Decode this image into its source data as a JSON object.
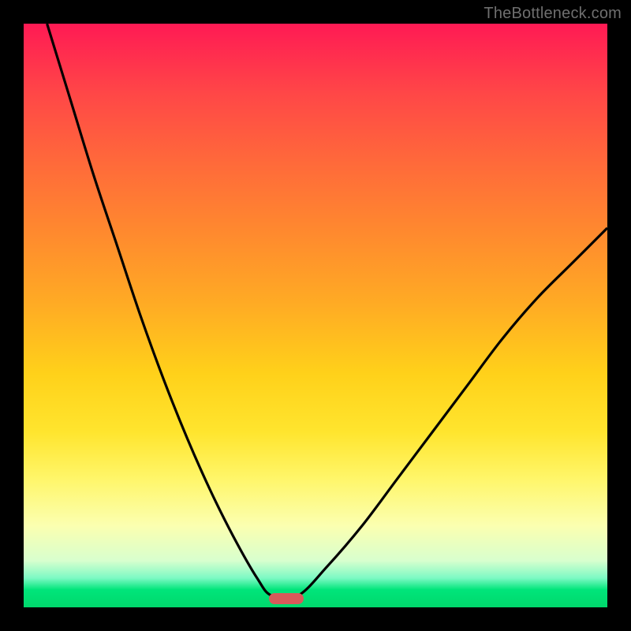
{
  "watermark": "TheBottleneck.com",
  "colors": {
    "page_bg": "#000000",
    "marker": "#d85a5a",
    "curve_stroke": "#000000"
  },
  "chart_data": {
    "type": "line",
    "title": "",
    "xlabel": "",
    "ylabel": "",
    "xlim": [
      0,
      100
    ],
    "ylim": [
      0,
      100
    ],
    "note": "Axes are unlabeled; values are estimated from pixel positions where x and y are normalized 0–100 within the gradient plot area (y = 0 at bottom, 100 at top).",
    "series": [
      {
        "name": "left-branch",
        "x": [
          4,
          8,
          12,
          16,
          20,
          24,
          28,
          32,
          36,
          40,
          42.5
        ],
        "values": [
          100,
          87,
          74,
          62,
          50,
          39,
          29,
          20,
          12,
          5,
          2
        ]
      },
      {
        "name": "right-branch",
        "x": [
          47,
          52,
          58,
          64,
          70,
          76,
          82,
          88,
          94,
          100
        ],
        "values": [
          2,
          7,
          14,
          22,
          30,
          38,
          46,
          53,
          59,
          65
        ]
      }
    ],
    "marker": {
      "x_center": 45,
      "width_pct": 6,
      "y": 1.5
    }
  }
}
